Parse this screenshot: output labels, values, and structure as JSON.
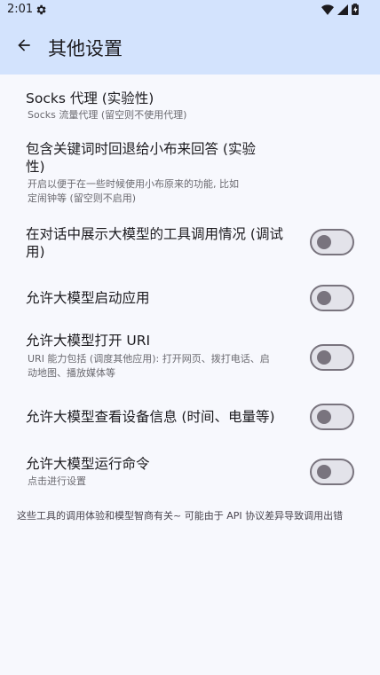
{
  "status_bar": {
    "time": "2:01",
    "icons": [
      "settings-gear-icon",
      "wifi-icon",
      "cellular-signal-icon",
      "battery-charging-icon"
    ]
  },
  "app_bar": {
    "back_icon": "arrow-back-icon",
    "title": "其他设置"
  },
  "settings": [
    {
      "title": "Socks 代理 (实验性)",
      "desc": "Socks 流量代理 (留空则不使用代理)"
    },
    {
      "title_lines": [
        "包含关键词时回退给小布来回答 (实验",
        "性)"
      ],
      "desc_lines": [
        "开启以便于在一些时候使用小布原来的功能, 比如",
        "定闹钟等 (留空则不启用)"
      ]
    },
    {
      "title_lines": [
        "在对话中展示大模型的工具调用情况 (调试",
        "用)"
      ],
      "toggle_on": false
    },
    {
      "title": "允许大模型启动应用",
      "toggle_on": false
    },
    {
      "title": "允许大模型打开 URI",
      "desc_lines": [
        "URI 能力包括 (调度其他应用): 打开网页、拨打电话、启",
        "动地图、播放媒体等"
      ],
      "toggle_on": false
    },
    {
      "title": "允许大模型查看设备信息 (时间、电量等)",
      "toggle_on": false
    },
    {
      "title": "允许大模型运行命令",
      "desc": "点击进行设置",
      "toggle_on": false
    }
  ],
  "footnote": "这些工具的调用体验和模型智商有关~ 可能由于 API 协议差异导致调用出错",
  "colors": {
    "app_bar_bg": "#d3e3fd",
    "page_bg": "#f7f8fd",
    "toggle_outline": "#79747e"
  }
}
